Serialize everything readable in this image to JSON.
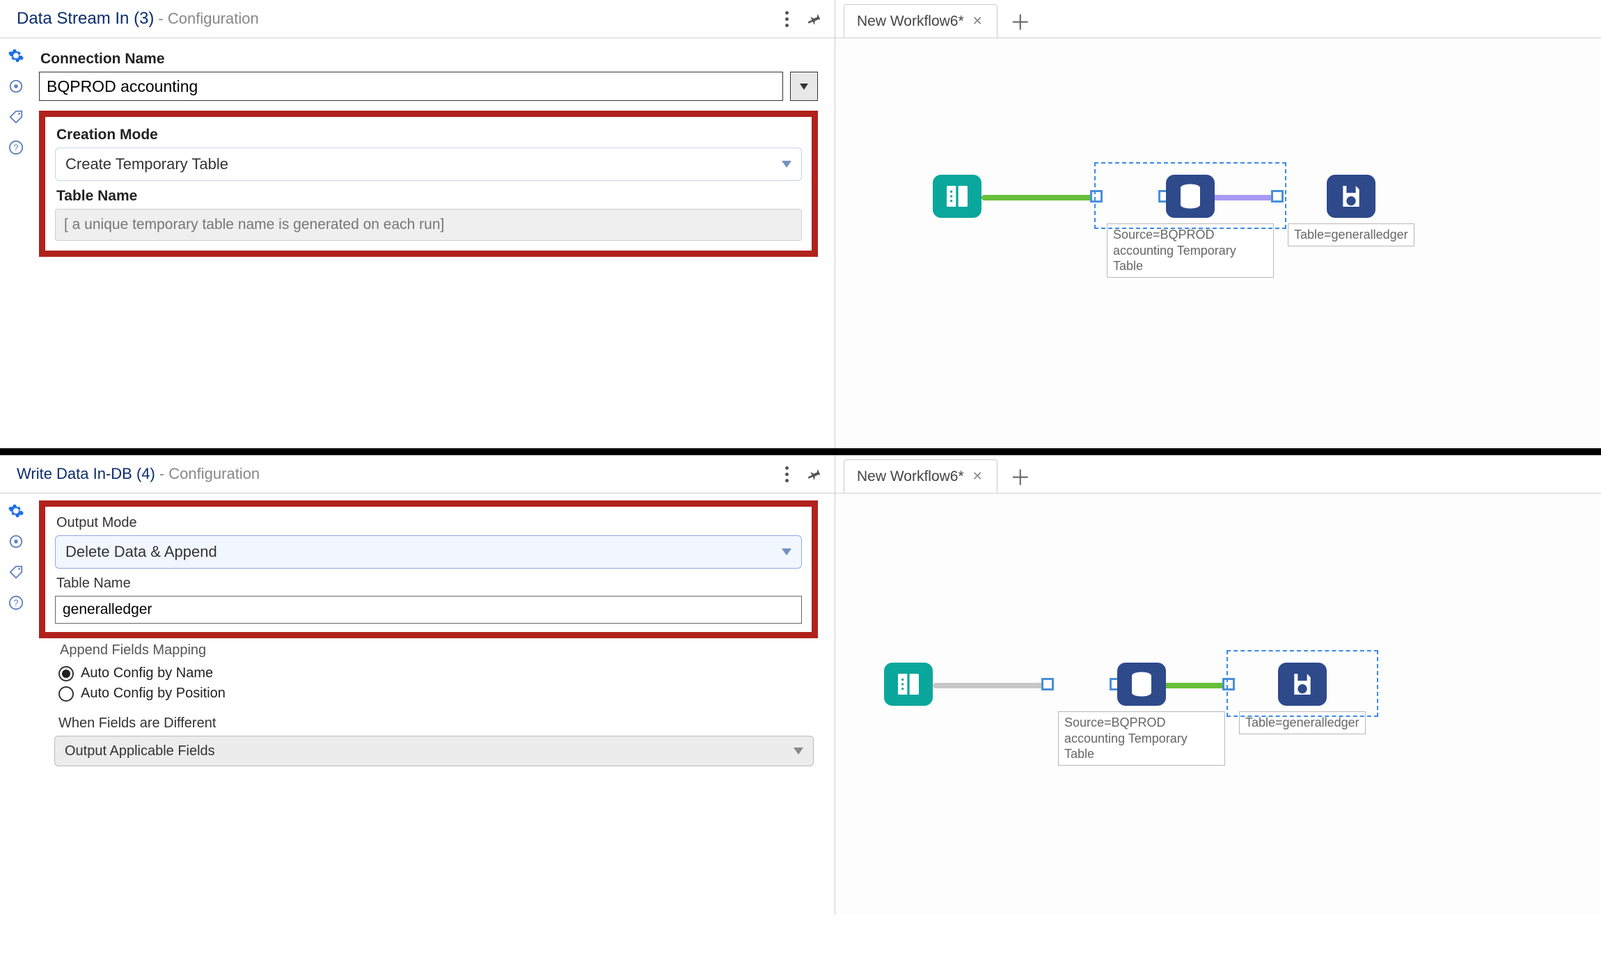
{
  "panels": {
    "top": {
      "header": {
        "title": "Data Stream In (3)",
        "suffix": " - Configuration"
      },
      "tabs": {
        "active": "New Workflow6*"
      },
      "form": {
        "connection_label": "Connection Name",
        "connection_value": "BQPROD accounting",
        "creation_mode_label": "Creation Mode",
        "creation_mode_value": "Create Temporary Table",
        "table_name_label": "Table Name",
        "table_name_placeholder": "[ a unique temporary table name is generated on each run]"
      },
      "canvas": {
        "node_db_caption": "Source=BQPROD accounting Temporary Table",
        "node_save_caption": "Table=generalledger"
      }
    },
    "bottom": {
      "header": {
        "title": "Write Data In-DB (4)",
        "suffix": " - Configuration"
      },
      "tabs": {
        "active": "New Workflow6*"
      },
      "form": {
        "output_mode_label": "Output Mode",
        "output_mode_value": "Delete Data & Append",
        "table_name_label": "Table Name",
        "table_name_value": "generalledger",
        "append_mapping_label": "Append Fields Mapping",
        "radio_by_name": "Auto Config by Name",
        "radio_by_position": "Auto Config by Position",
        "when_diff_label": "When Fields are Different",
        "when_diff_value": "Output Applicable Fields"
      },
      "canvas": {
        "node_db_caption": "Source=BQPROD accounting Temporary Table",
        "node_save_caption": "Table=generalledger"
      }
    }
  }
}
